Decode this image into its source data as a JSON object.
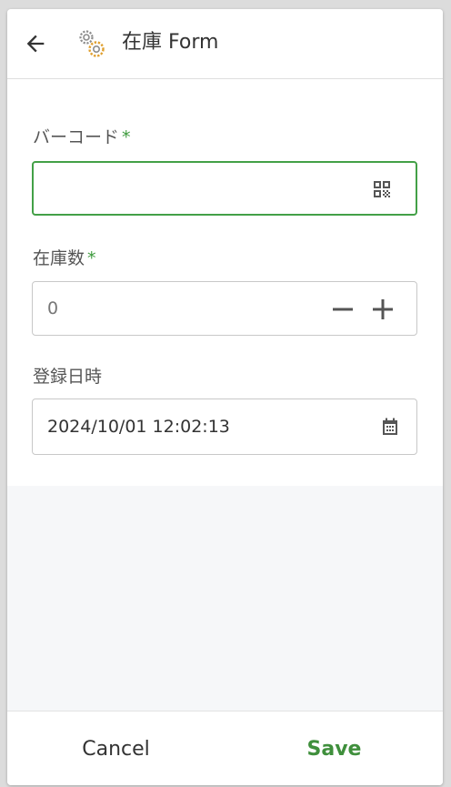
{
  "header": {
    "title": "在庫 Form",
    "back_icon": "arrow-left-icon",
    "app_icon": "gears-icon"
  },
  "form": {
    "barcode": {
      "label": "バーコード",
      "required_mark": "*",
      "value": "",
      "icon": "qr-code-scan-icon"
    },
    "quantity": {
      "label": "在庫数",
      "required_mark": "*",
      "placeholder": "0",
      "value": "",
      "decrement_icon": "minus-icon",
      "increment_icon": "plus-icon"
    },
    "registered_at": {
      "label": "登録日時",
      "value": "2024/10/01 12:02:13",
      "icon": "calendar-icon"
    }
  },
  "footer": {
    "cancel_label": "Cancel",
    "save_label": "Save"
  },
  "colors": {
    "accent": "#43a047",
    "save_text": "#3f8f3c",
    "required_mark": "#3c9a3c"
  }
}
